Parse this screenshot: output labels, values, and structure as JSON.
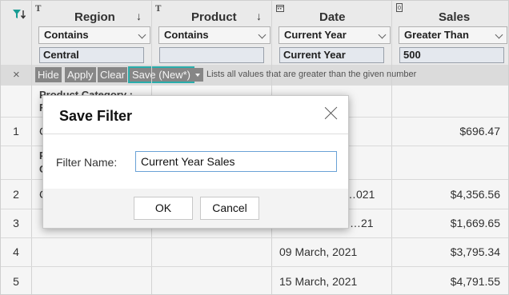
{
  "columns": [
    {
      "type_icon": "T",
      "title": "Region",
      "sort_icon": "↓"
    },
    {
      "type_icon": "T",
      "title": "Product",
      "sort_icon": "↓"
    },
    {
      "type_icon": "calendar-icon",
      "title": "Date"
    },
    {
      "type_icon": "number-icon",
      "title": "Sales"
    }
  ],
  "filters": {
    "operators": [
      "Contains",
      "Contains",
      "Current Year",
      "Greater Than"
    ],
    "values": [
      "Central",
      "",
      "Current Year",
      "500"
    ]
  },
  "action_bar": {
    "close": "×",
    "hide": "Hide",
    "apply": "Apply",
    "clear": "Clear",
    "save": "Save (New*)",
    "hint": "Lists all values that are greater than the given number"
  },
  "table": {
    "row_numbers": [
      "1",
      "2",
      "3",
      "4",
      "5"
    ],
    "category_label_line1": "Product Category :",
    "category_label_line2": "F",
    "group_letters": [
      "P",
      "C"
    ],
    "row_letters": [
      "C",
      "C"
    ],
    "dates": [
      "…021",
      "…21",
      "09 March, 2021",
      "15 March, 2021"
    ],
    "sales": [
      "$696.47",
      "$4,356.56",
      "$1,669.65",
      "$3,795.34",
      "$4,791.55"
    ]
  },
  "dialog": {
    "title": "Save Filter",
    "field_label": "Filter Name:",
    "field_value": "Current Year Sales",
    "ok": "OK",
    "cancel": "Cancel"
  },
  "colors": {
    "accent_teal": "#2bb5b2",
    "filter_icon_teal": "#18a39a",
    "input_focus_blue": "#6aa2d6"
  }
}
